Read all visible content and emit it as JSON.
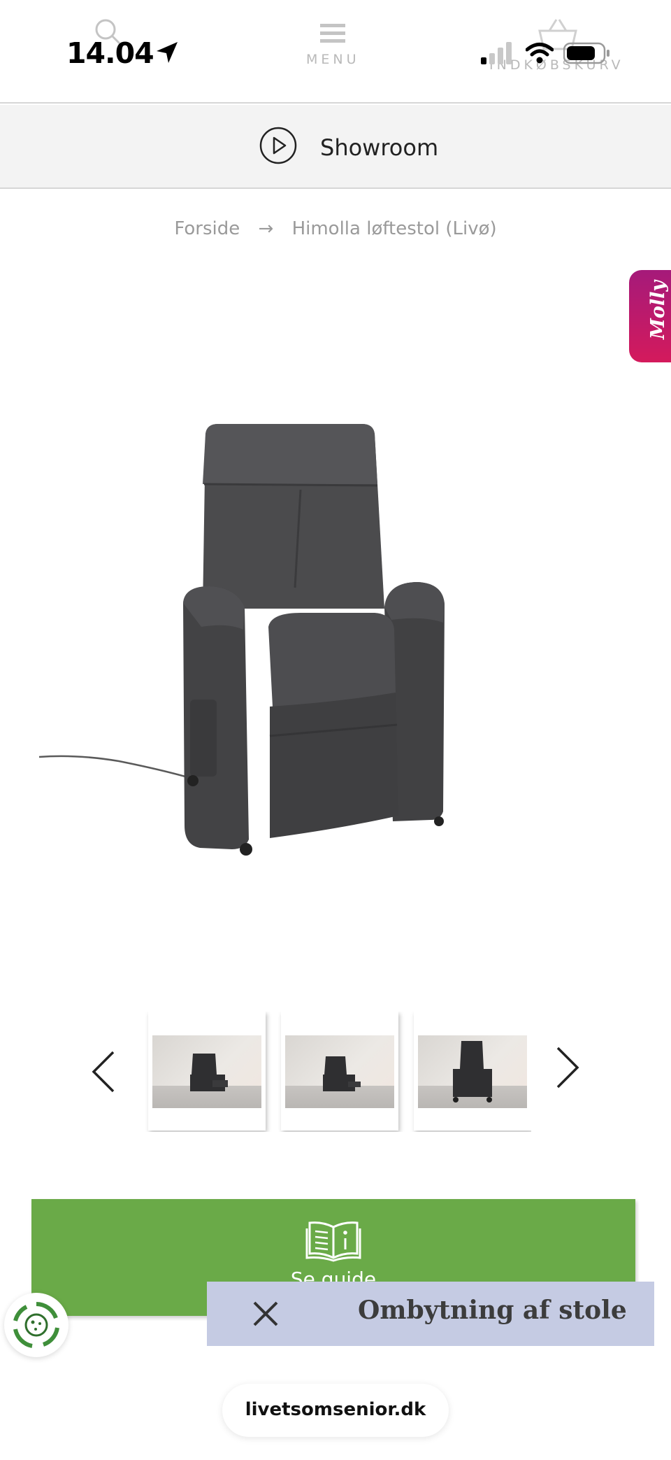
{
  "status_bar": {
    "time": "14.04",
    "location_icon": "location-arrow-icon",
    "signal_icon": "cellular-signal-icon",
    "wifi_icon": "wifi-icon",
    "battery_icon": "battery-icon"
  },
  "header": {
    "search_icon": "search-icon",
    "menu_label": "MENU",
    "menu_icon": "hamburger-icon",
    "cart_label": "INDKØBSKURV",
    "cart_icon": "basket-icon"
  },
  "showroom": {
    "label": "Showroom",
    "icon": "play-circle-icon"
  },
  "breadcrumb": {
    "home": "Forside",
    "separator_icon": "arrow-right-icon",
    "current": "Himolla løftestol (Livø)"
  },
  "molly_tab": {
    "label": "Molly"
  },
  "gallery": {
    "main_image": "recliner-chair-grey",
    "prev_icon": "chevron-left-icon",
    "next_icon": "chevron-right-icon",
    "thumbnails": [
      {
        "name": "thumbnail-1"
      },
      {
        "name": "thumbnail-2"
      },
      {
        "name": "thumbnail-3"
      }
    ]
  },
  "guide_button": {
    "label": "Se guide",
    "icon": "book-info-icon",
    "color": "#6aaa48"
  },
  "popup": {
    "title": "Ombytning af stole",
    "close_icon": "close-icon",
    "color": "#c5cbe3"
  },
  "cookie_button": {
    "icon": "cookie-settings-icon"
  },
  "browser": {
    "url": "livetsomsenior.dk"
  }
}
